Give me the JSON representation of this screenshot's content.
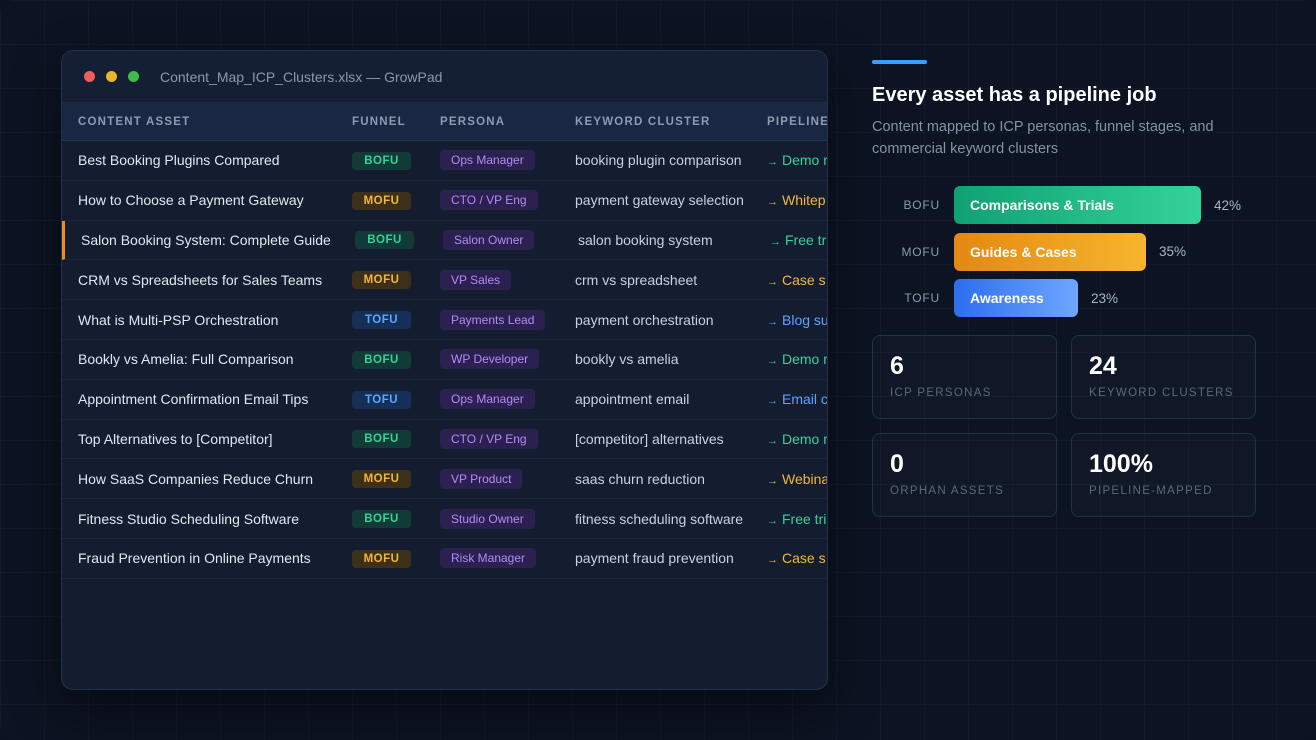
{
  "window": {
    "title": "Content_Map_ICP_Clusters.xlsx — GrowPad"
  },
  "table": {
    "headers": [
      "CONTENT ASSET",
      "FUNNEL",
      "PERSONA",
      "KEYWORD CLUSTER",
      "PIPELINE"
    ],
    "rows": [
      {
        "asset": "Best Booking Plugins Compared",
        "funnel": "BOFU",
        "persona": "Ops Manager",
        "keyword": "booking plugin comparison",
        "pipeline": "Demo r"
      },
      {
        "asset": "How to Choose a Payment Gateway",
        "funnel": "MOFU",
        "persona": "CTO / VP Eng",
        "keyword": "payment gateway selection",
        "pipeline": "Whitep"
      },
      {
        "asset": "Salon Booking System: Complete Guide",
        "funnel": "BOFU",
        "persona": "Salon Owner",
        "keyword": "salon booking system",
        "pipeline": "Free tri"
      },
      {
        "asset": "CRM vs Spreadsheets for Sales Teams",
        "funnel": "MOFU",
        "persona": "VP Sales",
        "keyword": "crm vs spreadsheet",
        "pipeline": "Case s"
      },
      {
        "asset": "What is Multi-PSP Orchestration",
        "funnel": "TOFU",
        "persona": "Payments Lead",
        "keyword": "payment orchestration",
        "pipeline": "Blog su"
      },
      {
        "asset": "Bookly vs Amelia: Full Comparison",
        "funnel": "BOFU",
        "persona": "WP Developer",
        "keyword": "bookly vs amelia",
        "pipeline": "Demo r"
      },
      {
        "asset": "Appointment Confirmation Email Tips",
        "funnel": "TOFU",
        "persona": "Ops Manager",
        "keyword": "appointment email",
        "pipeline": "Email c"
      },
      {
        "asset": "Top Alternatives to [Competitor]",
        "funnel": "BOFU",
        "persona": "CTO / VP Eng",
        "keyword": "[competitor] alternatives",
        "pipeline": "Demo r"
      },
      {
        "asset": "How SaaS Companies Reduce Churn",
        "funnel": "MOFU",
        "persona": "VP Product",
        "keyword": "saas churn reduction",
        "pipeline": "Webina"
      },
      {
        "asset": "Fitness Studio Scheduling Software",
        "funnel": "BOFU",
        "persona": "Studio Owner",
        "keyword": "fitness scheduling software",
        "pipeline": "Free tri"
      },
      {
        "asset": "Fraud Prevention in Online Payments",
        "funnel": "MOFU",
        "persona": "Risk Manager",
        "keyword": "payment fraud prevention",
        "pipeline": "Case s"
      }
    ],
    "arrow": "→",
    "colors": {
      "BOFU": "#34d399",
      "MOFU": "#f5b53b",
      "TOFU": "#5aa6ff",
      "active_marker": "#f08a24"
    }
  },
  "panel": {
    "heading": "Every asset has a pipeline job",
    "subtitle": "Content mapped to ICP personas, funnel stages, and commercial keyword clusters",
    "bars": [
      {
        "stage": "BOFU",
        "label": "Comparisons & Trials",
        "pct": "42%",
        "value": 42
      },
      {
        "stage": "MOFU",
        "label": "Guides & Cases",
        "pct": "35%",
        "value": 35
      },
      {
        "stage": "TOFU",
        "label": "Awareness",
        "pct": "23%",
        "value": 23
      }
    ],
    "stats": [
      {
        "value": "6",
        "label": "ICP PERSONAS"
      },
      {
        "value": "24",
        "label": "KEYWORD CLUSTERS"
      },
      {
        "value": "0",
        "label": "ORPHAN ASSETS"
      },
      {
        "value": "100%",
        "label": "PIPELINE-MAPPED"
      }
    ]
  }
}
